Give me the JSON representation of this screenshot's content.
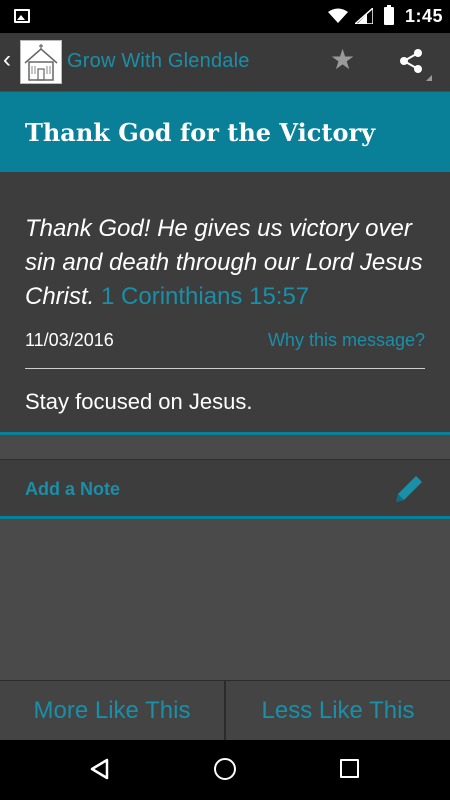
{
  "status_bar": {
    "time": "1:45",
    "icons": [
      "image-notification-icon",
      "wifi-icon",
      "signal-icon",
      "battery-icon"
    ]
  },
  "action_bar": {
    "back_icon": "chevron-left-icon",
    "logo_icon": "church-logo-icon",
    "title": "Grow With Glendale",
    "favorite_icon": "star-icon",
    "share_icon": "share-icon"
  },
  "message": {
    "title": "Thank God for the Victory",
    "verse_text": "Thank God! He gives us victory over sin and death through our Lord Jesus Christ.",
    "verse_reference": "1 Corinthians 15:57",
    "date": "11/03/2016",
    "why_link": "Why this message?",
    "body": "Stay focused on Jesus."
  },
  "note": {
    "label": "Add a Note",
    "icon": "pencil-icon"
  },
  "feedback": {
    "more_label": "More Like This",
    "less_label": "Less Like This"
  },
  "nav_bar": {
    "icons": [
      "back-triangle-icon",
      "home-circle-icon",
      "recents-square-icon"
    ]
  },
  "colors": {
    "accent": "#0a8098",
    "accent_text": "#1a8fa8",
    "background": "#4a4a4a",
    "card": "#3d3d3d"
  }
}
